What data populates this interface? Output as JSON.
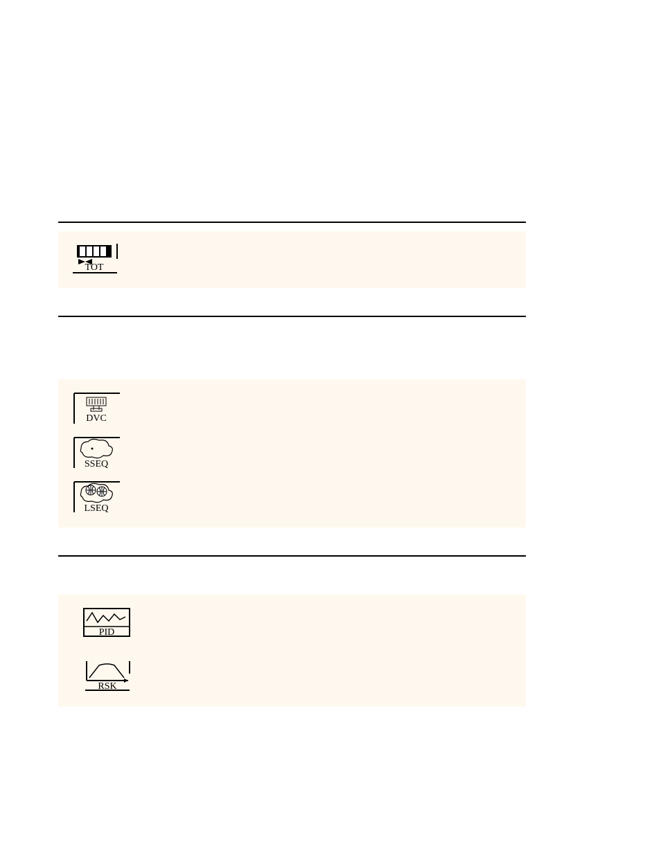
{
  "section1": {
    "items": [
      {
        "icon": "tot-icon",
        "label": "TOT"
      }
    ]
  },
  "section2": {
    "items": [
      {
        "icon": "dvc-icon",
        "label": "DVC"
      },
      {
        "icon": "sseq-icon",
        "label": "SSEQ"
      },
      {
        "icon": "lseq-icon",
        "label": "LSEQ"
      }
    ]
  },
  "section3": {
    "items": [
      {
        "icon": "pid-icon",
        "label": "PID"
      },
      {
        "icon": "rsk-icon",
        "label": "RSK"
      }
    ]
  }
}
